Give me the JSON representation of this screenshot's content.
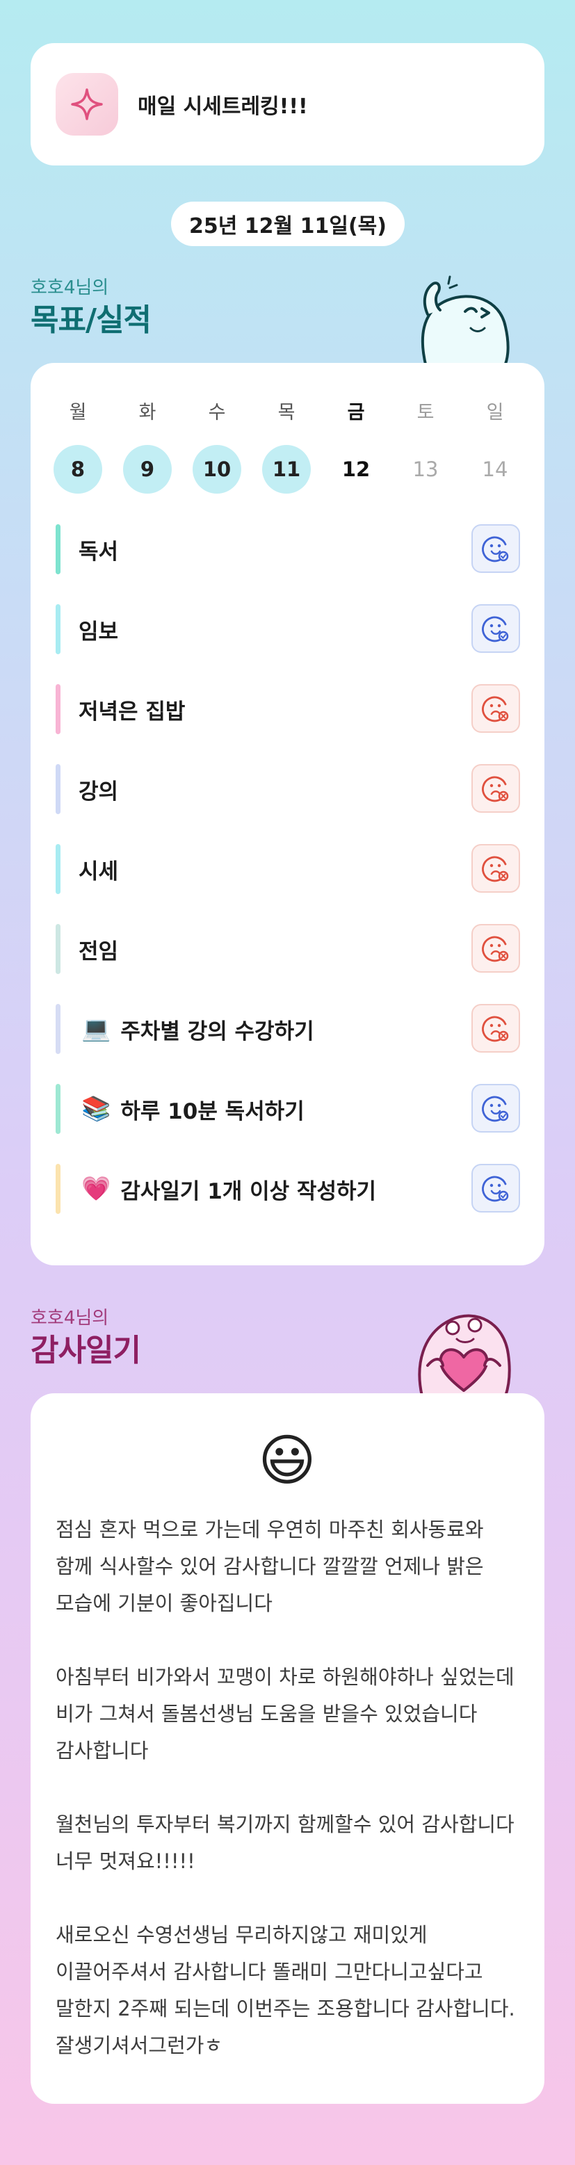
{
  "banner": {
    "title": "매일 시세트레킹!!!",
    "icon": "sparkle-icon"
  },
  "date": "25년 12월 11일(목)",
  "goals_section": {
    "subtitle": "호호4님의",
    "title": "목표/실적"
  },
  "week": [
    {
      "label": "월",
      "num": "8",
      "state": "done"
    },
    {
      "label": "화",
      "num": "9",
      "state": "done"
    },
    {
      "label": "수",
      "num": "10",
      "state": "done"
    },
    {
      "label": "목",
      "num": "11",
      "state": "done"
    },
    {
      "label": "금",
      "num": "12",
      "state": "today"
    },
    {
      "label": "토",
      "num": "13",
      "state": "future"
    },
    {
      "label": "일",
      "num": "14",
      "state": "future"
    }
  ],
  "goals": [
    {
      "label": "독서",
      "emoji": "",
      "status": "success",
      "bar_color": "#7ee3cf"
    },
    {
      "label": "임보",
      "emoji": "",
      "status": "success",
      "bar_color": "#a8ecf2"
    },
    {
      "label": "저녁은 집밥",
      "emoji": "",
      "status": "fail",
      "bar_color": "#f8b4d4"
    },
    {
      "label": "강의",
      "emoji": "",
      "status": "fail",
      "bar_color": "#cfd9f6"
    },
    {
      "label": "시세",
      "emoji": "",
      "status": "fail",
      "bar_color": "#a8ecf2"
    },
    {
      "label": "전임",
      "emoji": "",
      "status": "fail",
      "bar_color": "#cde7e3"
    },
    {
      "label": "주차별 강의 수강하기",
      "emoji": "💻",
      "status": "fail",
      "bar_color": "#d6dcf4"
    },
    {
      "label": "하루 10분 독서하기",
      "emoji": "📚",
      "status": "success",
      "bar_color": "#9ee8d3"
    },
    {
      "label": "감사일기 1개 이상 작성하기",
      "emoji": "💗",
      "status": "success",
      "bar_color": "#fbe3ae"
    }
  ],
  "diary_section": {
    "subtitle": "호호4님의",
    "title": "감사일기"
  },
  "diary": {
    "emoji": "😃",
    "text": "점심 혼자 먹으로 가는데 우연히 마주친 회사동료와 함께 식사할수 있어 감사합니다 깔깔깔 언제나 밝은 모습에 기분이 좋아집니다\n\n아침부터 비가와서 꼬맹이 차로 하원해야하나 싶었는데 비가 그쳐서 돌봄선생님 도움을 받을수 있었습니다 감사합니다\n\n월천님의 투자부터 복기까지 함께할수 있어 감사합니다 너무 멋져요!!!!!\n\n새로오신 수영선생님 무리하지않고 재미있게 이끌어주셔서 감사합니다 똘래미 그만다니고싶다고 말한지 2주째 되는데 이번주는 조용합니다 감사합니다. 잘생기셔서그런가ㅎ"
  },
  "colors": {
    "done_day": "#c2eef4",
    "success_icon": "#3f63d6",
    "fail_icon": "#e0503e",
    "goals_title": "#0f6e72",
    "diary_title": "#8e1f62"
  }
}
